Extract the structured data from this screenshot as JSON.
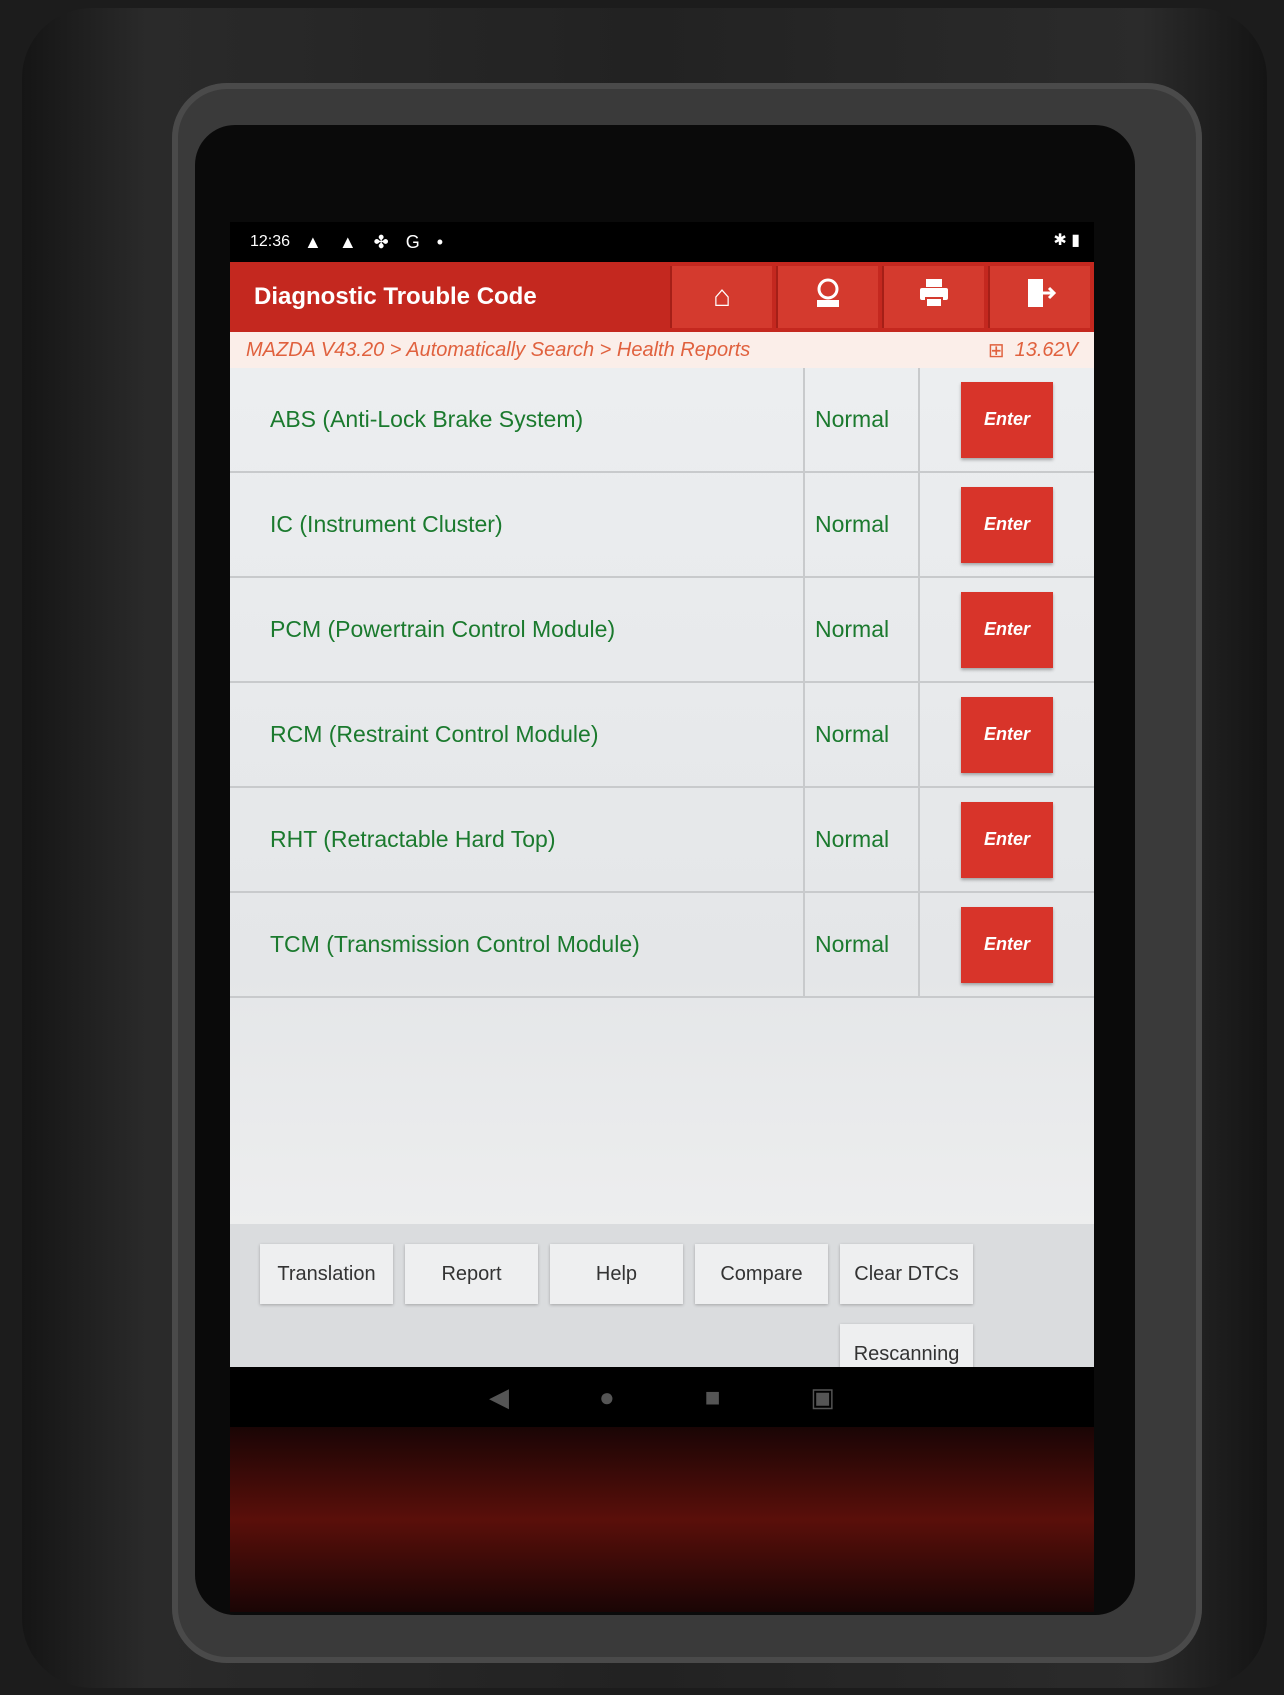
{
  "statusbar": {
    "time": "12:36",
    "icons": "▲ ▲ ✤ G •",
    "right": "✱ ▮"
  },
  "header": {
    "title": "Diagnostic Trouble Code",
    "icons": [
      "home-icon",
      "user-icon",
      "print-icon",
      "exit-icon"
    ]
  },
  "breadcrumb": {
    "path": "MAZDA V43.20 > Automatically Search > Health Reports",
    "voltage": "13.62V",
    "battery_icon": "⊞"
  },
  "modules": [
    {
      "name": "ABS (Anti-Lock Brake System)",
      "status": "Normal",
      "action": "Enter"
    },
    {
      "name": "IC (Instrument Cluster)",
      "status": "Normal",
      "action": "Enter"
    },
    {
      "name": "PCM (Powertrain Control Module)",
      "status": "Normal",
      "action": "Enter"
    },
    {
      "name": "RCM (Restraint Control Module)",
      "status": "Normal",
      "action": "Enter"
    },
    {
      "name": "RHT (Retractable Hard Top)",
      "status": "Normal",
      "action": "Enter"
    },
    {
      "name": "TCM (Transmission Control Module)",
      "status": "Normal",
      "action": "Enter"
    }
  ],
  "footer": {
    "translation": "Translation",
    "report": "Report",
    "help": "Help",
    "compare": "Compare",
    "clear_dtcs": "Clear DTCs",
    "rescanning": "Rescanning"
  },
  "colors": {
    "header": "#c4281f",
    "status_text": "#1b7a2e",
    "enter_button": "#d8342a",
    "breadcrumb": "#e0613e"
  }
}
